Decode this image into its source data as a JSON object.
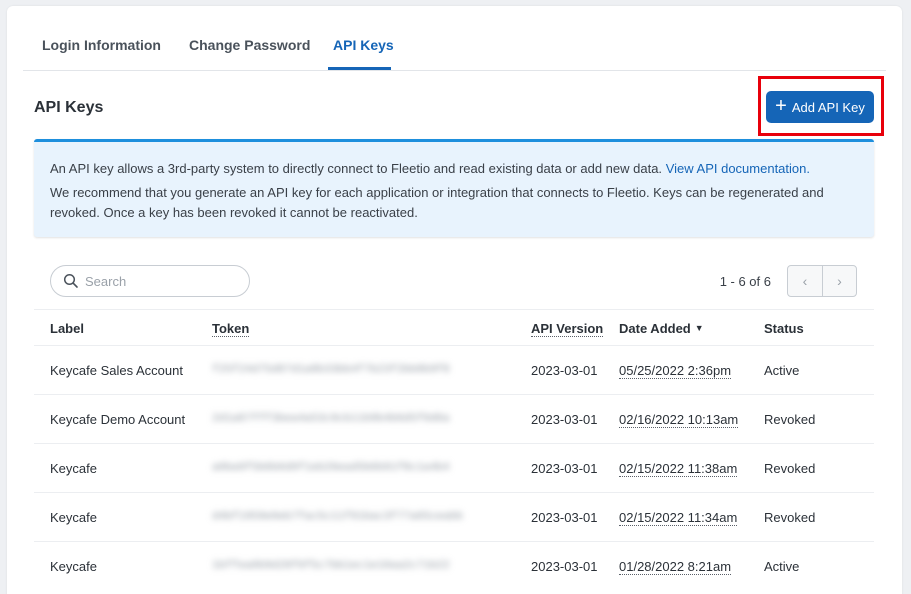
{
  "tabs": [
    {
      "label": "Login Information",
      "active": false
    },
    {
      "label": "Change Password",
      "active": false
    },
    {
      "label": "API Keys",
      "active": true
    }
  ],
  "section_title": "API Keys",
  "add_button_label": "Add API Key",
  "info": {
    "line1_text": "An API key allows a 3rd-party system to directly connect to Fleetio and read existing data or add new data.",
    "line1_link": "View API documentation.",
    "line2": "We recommend that you generate an API key for each application or integration that connects to Fleetio. Keys can be regenerated and revoked. Once a key has been revoked it cannot be reactivated."
  },
  "search": {
    "placeholder": "Search",
    "value": ""
  },
  "pagination": {
    "range_text": "1 - 6 of 6",
    "prev": "‹",
    "next": "›"
  },
  "table": {
    "columns": [
      "Label",
      "Token",
      "API Version",
      "Date Added",
      "Status"
    ],
    "rows": [
      {
        "label": "Keycafe Sales Account",
        "token": "f25f24d75d87d1a8b33bb4f7b23f2bb8b9f8",
        "version": "2023-03-01",
        "date": "05/25/2022 2:36pm",
        "status": "Active"
      },
      {
        "label": "Keycafe Demo Account",
        "token": "2d1a87fff3bea4a53c9cb11b9b4b6d5f0d6a",
        "version": "2023-03-01",
        "date": "02/16/2022 10:13am",
        "status": "Revoked"
      },
      {
        "label": "Keycafe",
        "token": "a0ba9f5b6b6d9f1eb26ead5b6b91f8c1a4b4",
        "version": "2023-03-01",
        "date": "02/15/2022 11:38am",
        "status": "Revoked"
      },
      {
        "label": "Keycafe",
        "token": "d4bf1959e0eb7fac5c11f91bac3f77a65ceabb",
        "version": "2023-03-01",
        "date": "02/15/2022 11:34am",
        "status": "Revoked"
      },
      {
        "label": "Keycafe",
        "token": "1bffea0b9d28f6f5c7bb1ec1e10aa2c71b22",
        "version": "2023-03-01",
        "date": "01/28/2022 8:21am",
        "status": "Active"
      }
    ]
  },
  "colors": {
    "accent": "#1565b7",
    "info_border": "#1d8fdd",
    "info_bg": "#e8f3fd",
    "highlight": "#e8000b"
  }
}
